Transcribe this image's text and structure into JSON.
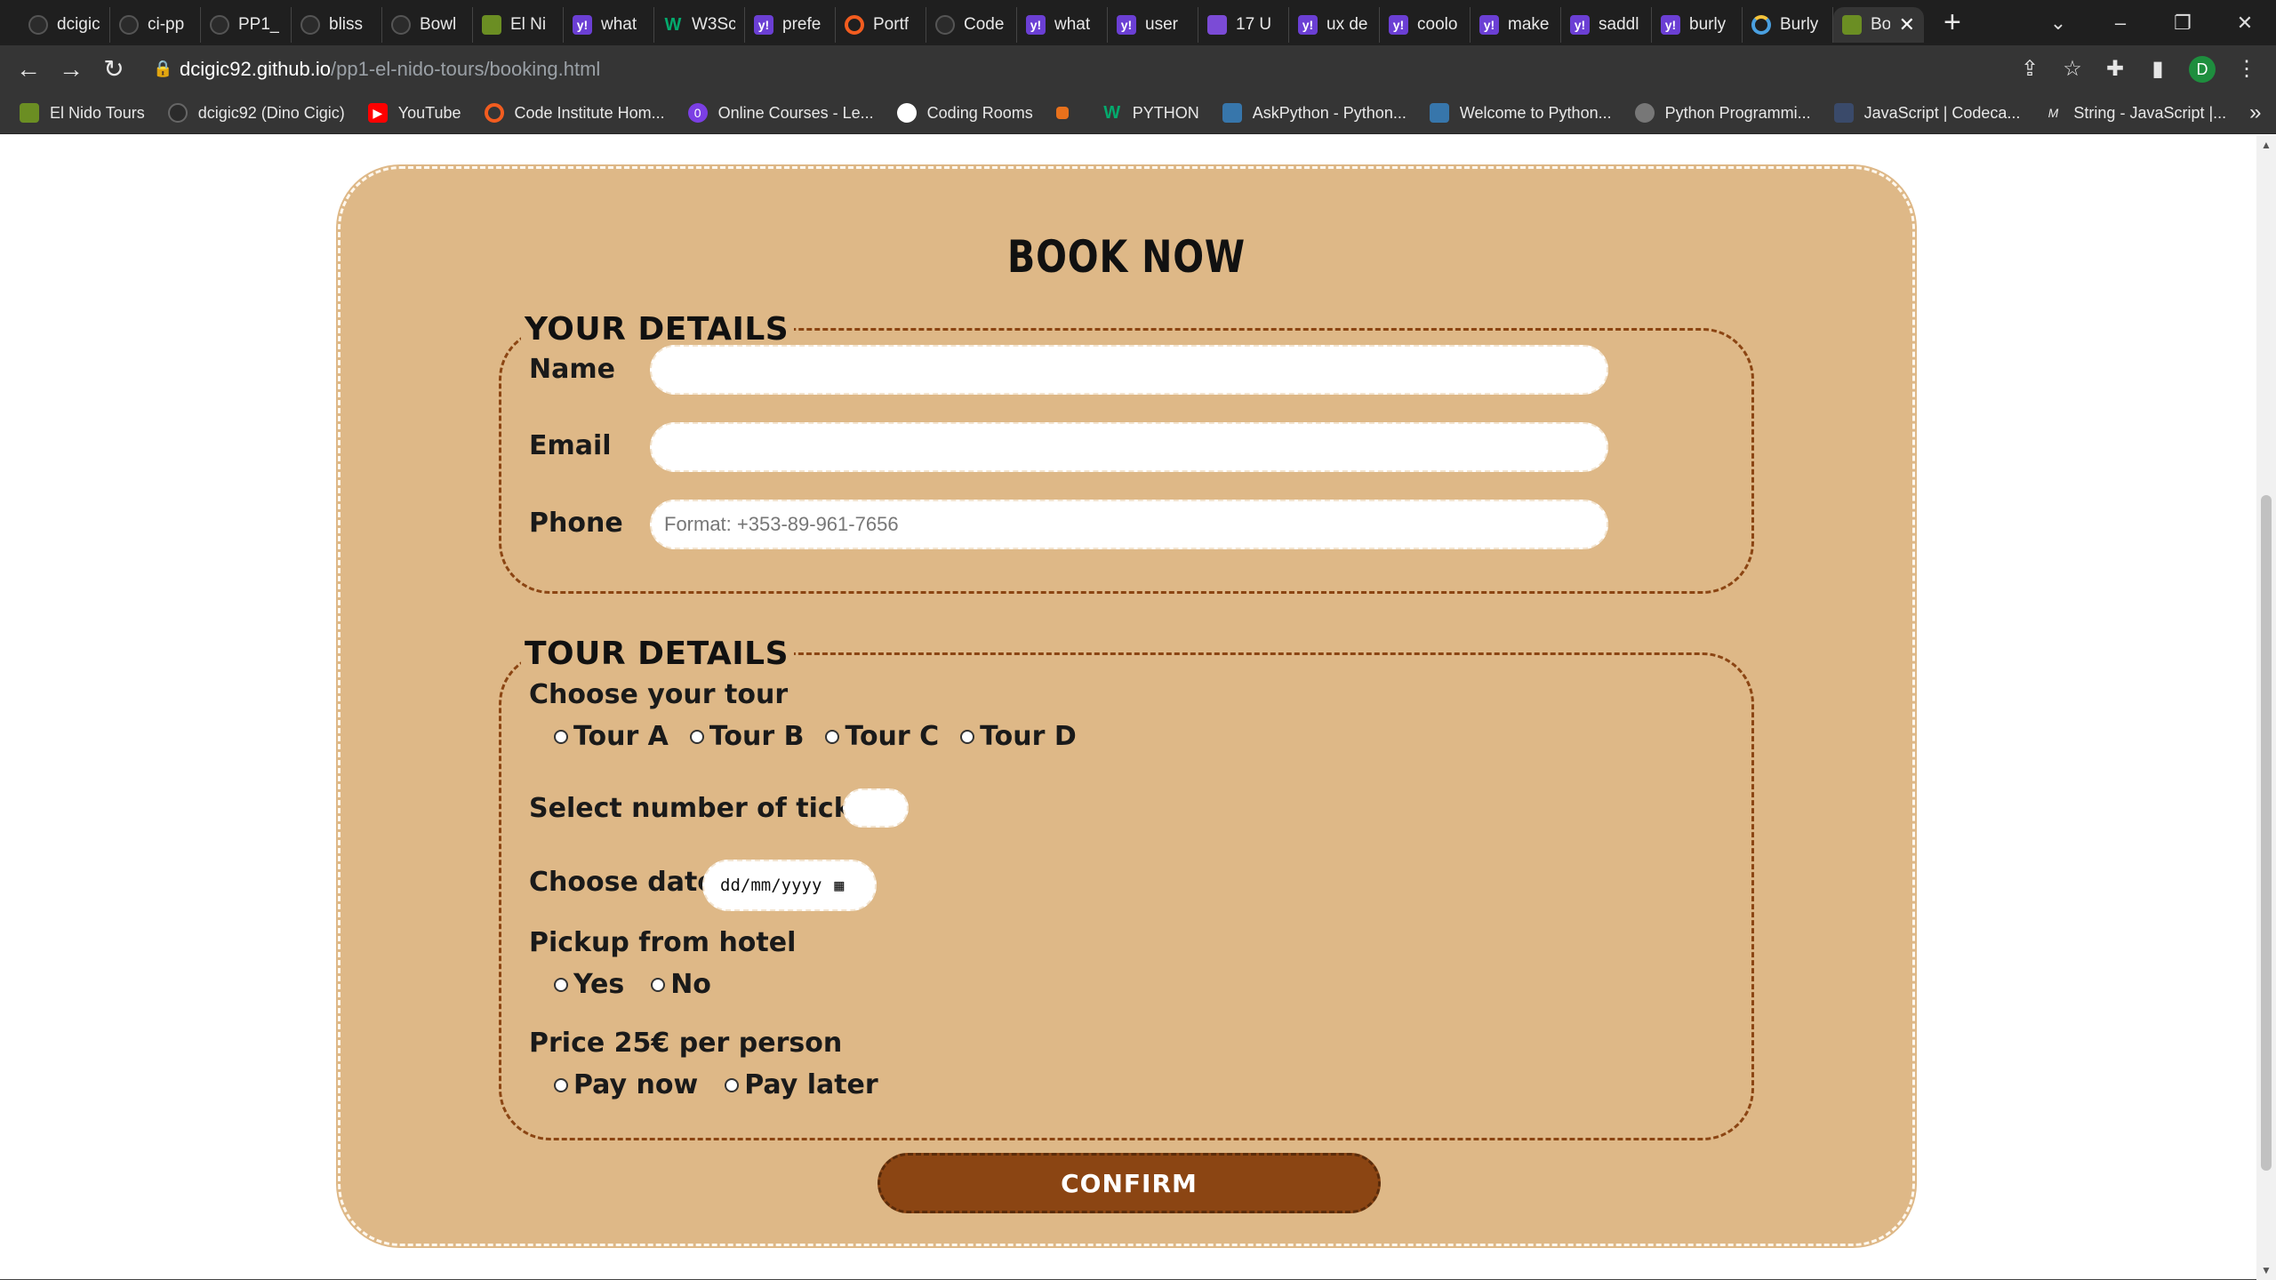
{
  "tabs": [
    {
      "title": "dcigic",
      "icon": "github-icon",
      "cls": "gh"
    },
    {
      "title": "ci-pp",
      "icon": "github-icon",
      "cls": "gh"
    },
    {
      "title": "PP1_",
      "icon": "github-icon",
      "cls": "gh"
    },
    {
      "title": "bliss",
      "icon": "github-icon",
      "cls": "gh"
    },
    {
      "title": "Bowl",
      "icon": "github-icon",
      "cls": "gh"
    },
    {
      "title": "El Ni",
      "icon": "el-nido-icon",
      "cls": "el"
    },
    {
      "title": "what",
      "icon": "yahoo-icon",
      "cls": "yo"
    },
    {
      "title": "W3Sc",
      "icon": "w3schools-icon",
      "cls": "w3"
    },
    {
      "title": "prefe",
      "icon": "yahoo-icon",
      "cls": "yo"
    },
    {
      "title": "Portf",
      "icon": "code-institute-icon",
      "cls": "or"
    },
    {
      "title": "Code",
      "icon": "github-icon",
      "cls": "gh"
    },
    {
      "title": "what",
      "icon": "yahoo-icon",
      "cls": "yo"
    },
    {
      "title": "user",
      "icon": "yahoo-icon",
      "cls": "yo"
    },
    {
      "title": "17 U",
      "icon": "site-icon",
      "cls": "m"
    },
    {
      "title": "ux de",
      "icon": "yahoo-icon",
      "cls": "yo"
    },
    {
      "title": "coolo",
      "icon": "yahoo-icon",
      "cls": "yo"
    },
    {
      "title": "make",
      "icon": "yahoo-icon",
      "cls": "yo"
    },
    {
      "title": "saddl",
      "icon": "yahoo-icon",
      "cls": "yo"
    },
    {
      "title": "burly",
      "icon": "yahoo-icon",
      "cls": "yo"
    },
    {
      "title": "Burly",
      "icon": "loading-icon",
      "cls": "bu"
    },
    {
      "title": "Bo",
      "icon": "el-nido-icon",
      "cls": "el",
      "active": true
    }
  ],
  "address": {
    "host": "dcigic92.github.io",
    "path": "/pp1-el-nido-tours/booking.html"
  },
  "bookmarks": [
    {
      "label": "El Nido Tours",
      "cls": "bi-el",
      "glyph": ""
    },
    {
      "label": "dcigic92 (Dino Cigic)",
      "cls": "bi-gh",
      "glyph": ""
    },
    {
      "label": "YouTube",
      "cls": "bi-yt",
      "glyph": "▶"
    },
    {
      "label": "Code Institute Hom...",
      "cls": "bi-ci",
      "glyph": ""
    },
    {
      "label": "Online Courses - Le...",
      "cls": "bi-oc",
      "glyph": "0"
    },
    {
      "label": "Coding Rooms",
      "cls": "bi-cr",
      "glyph": ""
    },
    {
      "label": "",
      "cls": "bi-sq",
      "glyph": ""
    },
    {
      "label": "PYTHON",
      "cls": "bi-w",
      "glyph": "W"
    },
    {
      "label": "AskPython - Python...",
      "cls": "bi-py",
      "glyph": ""
    },
    {
      "label": "Welcome to Python...",
      "cls": "bi-py",
      "glyph": ""
    },
    {
      "label": "Python Programmi...",
      "cls": "bi-pp",
      "glyph": ""
    },
    {
      "label": "JavaScript | Codeca...",
      "cls": "bi-js",
      "glyph": ""
    },
    {
      "label": "String - JavaScript |...",
      "cls": "bi-m",
      "glyph": "M"
    }
  ],
  "form": {
    "title": "BOOK NOW",
    "your_details": {
      "legend": "YOUR DETAILS",
      "name_label": "Name",
      "email_label": "Email",
      "phone_label": "Phone",
      "phone_placeholder": "Format: +353-89-961-7656"
    },
    "tour_details": {
      "legend": "TOUR DETAILS",
      "choose_tour_label": "Choose your tour",
      "tours": [
        "Tour A",
        "Tour B",
        "Tour C",
        "Tour D"
      ],
      "tickets_label": "Select number of tickets",
      "date_label": "Choose date",
      "date_placeholder": "dd/mm/yyyy",
      "pickup_label": "Pickup from hotel",
      "pickup_options": [
        "Yes",
        "No"
      ],
      "price_label": "Price 25€ per person",
      "payment_options": [
        "Pay now",
        "Pay later"
      ]
    },
    "confirm_label": "CONFIRM"
  }
}
